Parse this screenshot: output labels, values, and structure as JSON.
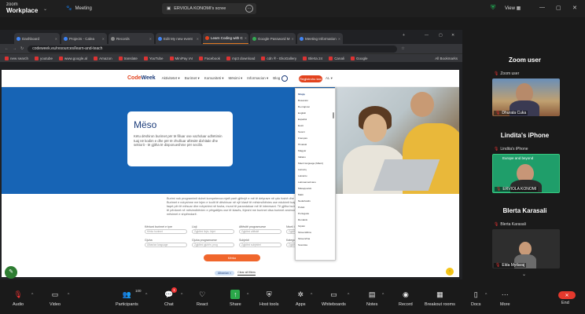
{
  "zoom": {
    "brand_line1": "zoom",
    "brand_line2": "Workplace",
    "meeting_label": "Meeting",
    "screen_share_title": "ERVIOLA KONOMI's scree",
    "view_label": "View"
  },
  "browser": {
    "tabs": [
      {
        "label": "Dashboard",
        "color": "#4285f4"
      },
      {
        "label": "Projects - Calea",
        "color": "#3b82f6"
      },
      {
        "label": "Records",
        "color": "#888888"
      },
      {
        "label": "Edit My new event",
        "color": "#4285f4"
      },
      {
        "label": "Learn Coding with C",
        "color": "#e2431e",
        "active": true
      },
      {
        "label": "Google Password M",
        "color": "#34a853"
      },
      {
        "label": "Meeting Information",
        "color": "#4285f4"
      }
    ],
    "url": "codeweek.eu/resources/learn-and-teach",
    "bookmarks": [
      "new search",
      "youtube",
      "www.google.al",
      "Amazon",
      "translate",
      "YouTube",
      "MiniPay IAI",
      "Facebook",
      "mp3 download",
      "cdn ® - EkoGallery",
      "Blerta 24",
      "Canali",
      "Google"
    ],
    "all_bookmarks": "All Bookmarks"
  },
  "codeweek": {
    "logo_a": "Code",
    "logo_b": "Week",
    "nav": [
      "Aktivitetet ▾",
      "Burimet ▾",
      "Komuniteti ▾",
      "Mësimi ▾",
      "Informacion ▾",
      "Blog"
    ],
    "register": "Regjistrohu tani",
    "lang": "AL ▾",
    "hero_title": "Mëso",
    "hero_desc": "Këtu dëshiron burimet për të filluar ose vazhduar udhëtimin tuaj në kodim e dhe për të zhvilluar aftësitë dixhitale dhe sektorit - të gjitha të disponueshme për secilin.",
    "intro_text": "Burimi nuk programimit duhet kompetenca mjaft parë gjithnjë e më të detyrave në çdo fushë dhe shkencore të arsimit. Burimet e ndryshme me lejen e kodit të dëshiruar në një klasë të mësimdhënies ose edukimit tuaj. Shikoni edhe burimet në faqet për të mësuar dhe ndryshimi në fusha, mund të parandaluar më të interesant. Të gjitha burimet janë falas. Burimi mund të përdoret në mësimdhënien e përgatitjes ose të klasës, thjesht me burimet disa burimet arsimore, të gjitha bazuar mbi mësimet e shpërndarë.",
    "filters": [
      [
        {
          "label": "Kërkoni burimet e tyre",
          "placeholder": "Kërko burimet"
        },
        {
          "label": "Lloji",
          "placeholder": "Zgjidhni llojin, llojet"
        },
        {
          "label": "Aftësitë programuese",
          "placeholder": "Zgjidhni aftësitë"
        },
        {
          "label": "Niveli i kompetencës",
          "placeholder": "Zgjidhni nivelin"
        }
      ],
      [
        {
          "label": "Gjuha",
          "placeholder": "Albanian language"
        },
        {
          "label": "Gjuha programuese",
          "placeholder": "Zgjidhni gjuhën, prog"
        },
        {
          "label": "Subjekti",
          "placeholder": "Zgjidhni subjektet"
        },
        {
          "label": "Kategoria",
          "placeholder": "Zgjidhni kategorinë"
        }
      ]
    ],
    "search_button": "Kërko",
    "chip1": "Albanian ×",
    "chip2": "Clear all filters",
    "languages": [
      "Shqip",
      "Bosanski",
      "Български",
      "English",
      "Español",
      "Eesti",
      "Suomi",
      "Français",
      "Hrvatski",
      "Magyar",
      "Italiano",
      "Maori language (Māori)",
      "Lietuvių",
      "Latviešu",
      "Latinoamericano",
      "Македонски",
      "Malti",
      "Nederlands",
      "Polski",
      "Português",
      "Română",
      "Srpski",
      "Slovenščina",
      "Slovenčina",
      "Svenska"
    ]
  },
  "gallery": {
    "p1_name": "Zoom user",
    "p1_small": "Zoom user",
    "p1_tile": "Dhurata Cuka",
    "p2_name": "Lindita's iPhone",
    "p2_small": "Lindita's iPhone",
    "p2_tile": "ERVIOLA KONOMI",
    "p2_overlay": "Europe and beyond",
    "p3_name": "Blerta Karasali",
    "p3_small": "Blerta Karasali",
    "p3_tile": "Elda Mytlaraj"
  },
  "toolbar": {
    "audio": "Audio",
    "video": "Video",
    "participants": "Participants",
    "participants_count": "100",
    "chat": "Chat",
    "chat_badge": "1",
    "react": "React",
    "share": "Share",
    "host_tools": "Host tools",
    "apps": "Apps",
    "whiteboards": "Whiteboards",
    "notes": "Notes",
    "record": "Record",
    "breakout": "Breakout rooms",
    "docs": "Docs",
    "more": "More",
    "end": "End"
  }
}
